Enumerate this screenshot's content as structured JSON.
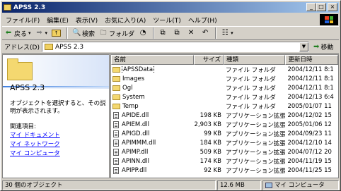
{
  "window": {
    "title": "APSS 2.3"
  },
  "menu": [
    "ファイル(F)",
    "編集(E)",
    "表示(V)",
    "お気に入り(A)",
    "ツール(T)",
    "ヘルプ(H)"
  ],
  "toolbar": {
    "back_label": "戻る",
    "forward_icon": "forward-arrow-icon",
    "search_label": "検索",
    "folders_label": "フォルダ"
  },
  "address": {
    "label": "アドレス(D)",
    "value": "APSS 2.3",
    "go_label": "移動"
  },
  "left_pane": {
    "title": "APSS 2.3",
    "description": "オブジェクトを選択すると、その説明が表示されます。",
    "related_label": "関連項目:",
    "links": [
      "マイ ドキュメント",
      "マイ ネットワーク",
      "マイ コンピュータ"
    ]
  },
  "columns": {
    "name": "名前",
    "size": "サイズ",
    "type": "種類",
    "date": "更新日時"
  },
  "files": [
    {
      "name": "APSSData",
      "size": "",
      "type": "ファイル フォルダ",
      "date": "2004/12/11 8:1",
      "kind": "folder"
    },
    {
      "name": "Images",
      "size": "",
      "type": "ファイル フォルダ",
      "date": "2004/12/11 8:1",
      "kind": "folder"
    },
    {
      "name": "Ogl",
      "size": "",
      "type": "ファイル フォルダ",
      "date": "2004/12/11 8:1",
      "kind": "folder"
    },
    {
      "name": "System",
      "size": "",
      "type": "ファイル フォルダ",
      "date": "2004/12/13 6:4",
      "kind": "folder"
    },
    {
      "name": "Temp",
      "size": "",
      "type": "ファイル フォルダ",
      "date": "2005/01/07 11",
      "kind": "folder"
    },
    {
      "name": "APIDE.dll",
      "size": "198 KB",
      "type": "アプリケーション拡張",
      "date": "2004/12/02 15",
      "kind": "file"
    },
    {
      "name": "APIEM.dll",
      "size": "2,903 KB",
      "type": "アプリケーション拡張",
      "date": "2005/01/06 12",
      "kind": "file"
    },
    {
      "name": "APIGD.dll",
      "size": "99 KB",
      "type": "アプリケーション拡張",
      "date": "2004/09/23 11",
      "kind": "file"
    },
    {
      "name": "APIMMM.dll",
      "size": "184 KB",
      "type": "アプリケーション拡張",
      "date": "2004/12/10 14",
      "kind": "file"
    },
    {
      "name": "APIMP.dll",
      "size": "509 KB",
      "type": "アプリケーション拡張",
      "date": "2004/07/12 20",
      "kind": "file"
    },
    {
      "name": "APINN.dll",
      "size": "174 KB",
      "type": "アプリケーション拡張",
      "date": "2004/11/19 15",
      "kind": "file"
    },
    {
      "name": "APIPP.dll",
      "size": "92 KB",
      "type": "アプリケーション拡張",
      "date": "2004/11/25 15",
      "kind": "file"
    }
  ],
  "status": {
    "objects": "30 個のオブジェクト",
    "size": "12.6 MB",
    "location": "マイ コンピュータ"
  }
}
